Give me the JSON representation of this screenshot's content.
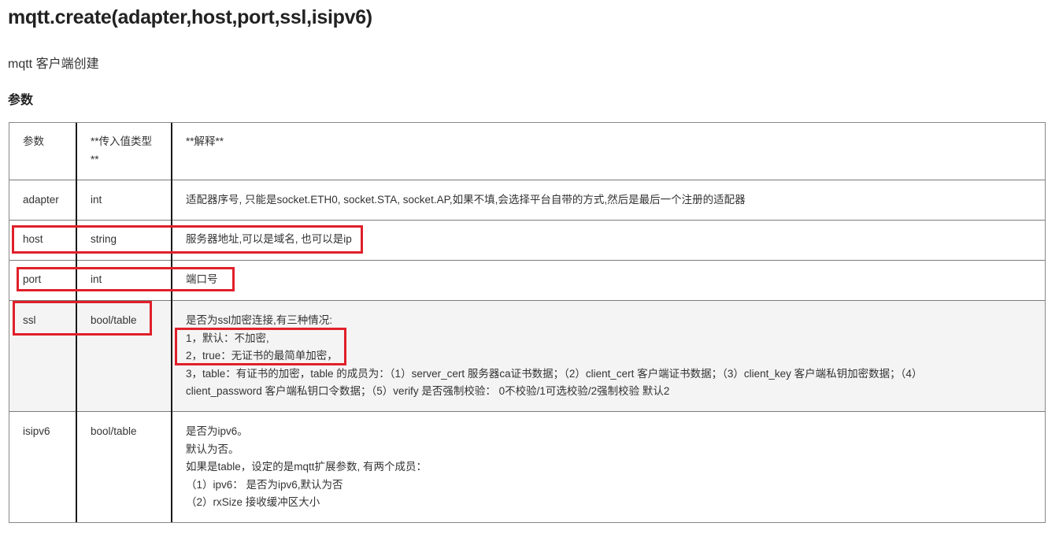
{
  "doc": {
    "title": "mqtt.create(adapter,host,port,ssl,isipv6)",
    "description": "mqtt 客户端创建",
    "section_heading": "参数"
  },
  "table": {
    "header": {
      "col1": "参数",
      "col2_line1": "**传入值类型",
      "col2_line2": "**",
      "col3": "**解释**"
    },
    "rows": [
      {
        "param": "adapter",
        "type": "int",
        "desc": [
          "适配器序号, 只能是socket.ETH0, socket.STA, socket.AP,如果不填,会选择平台自带的方式,然后是最后一个注册的适配器"
        ]
      },
      {
        "param": "host",
        "type": "string",
        "desc": [
          "服务器地址,可以是域名, 也可以是ip"
        ]
      },
      {
        "param": "port",
        "type": "int",
        "desc": [
          "端口号"
        ]
      },
      {
        "param": "ssl",
        "type": "bool/table",
        "desc": [
          "是否为ssl加密连接,有三种情况:",
          "1，默认：不加密,",
          "2，true：无证书的最简单加密，",
          "3，table：有证书的加密，table 的成员为：（1）server_cert 服务器ca证书数据；（2）client_cert 客户端证书数据；（3）client_key 客户端私钥加密数据；（4）",
          "client_password 客户端私钥口令数据；（5）verify 是否强制校验： 0不校验/1可选校验/2强制校验 默认2"
        ]
      },
      {
        "param": "isipv6",
        "type": "bool/table",
        "desc": [
          "是否为ipv6。",
          "默认为否。",
          "如果是table，设定的是mqtt扩展参数, 有两个成员：",
          "（1）ipv6： 是否为ipv6,默认为否",
          "（2）rxSize 接收缓冲区大小"
        ]
      }
    ]
  },
  "highlight_color": "#e0202a"
}
